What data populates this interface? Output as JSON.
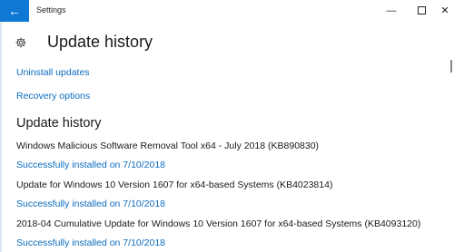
{
  "window": {
    "title": "Settings",
    "back_icon": "←",
    "minimize_icon": "—",
    "close_icon": "✕"
  },
  "header": {
    "icon": "gear-icon",
    "title": "Update history"
  },
  "links": {
    "uninstall": "Uninstall updates",
    "recovery": "Recovery options"
  },
  "history": {
    "title": "Update history",
    "items": [
      {
        "name": "Windows Malicious Software Removal Tool x64 - July 2018 (KB890830)",
        "status": "Successfully installed on 7/10/2018"
      },
      {
        "name": "Update for Windows 10 Version 1607 for x64-based Systems (KB4023814)",
        "status": "Successfully installed on 7/10/2018"
      },
      {
        "name": "2018-04 Cumulative Update for Windows 10 Version 1607 for x64-based Systems (KB4093120)",
        "status": "Successfully installed on 7/10/2018"
      }
    ]
  },
  "colors": {
    "accent": "#0f78d4",
    "link": "#0b6bbf",
    "text": "#1a1a1a"
  }
}
